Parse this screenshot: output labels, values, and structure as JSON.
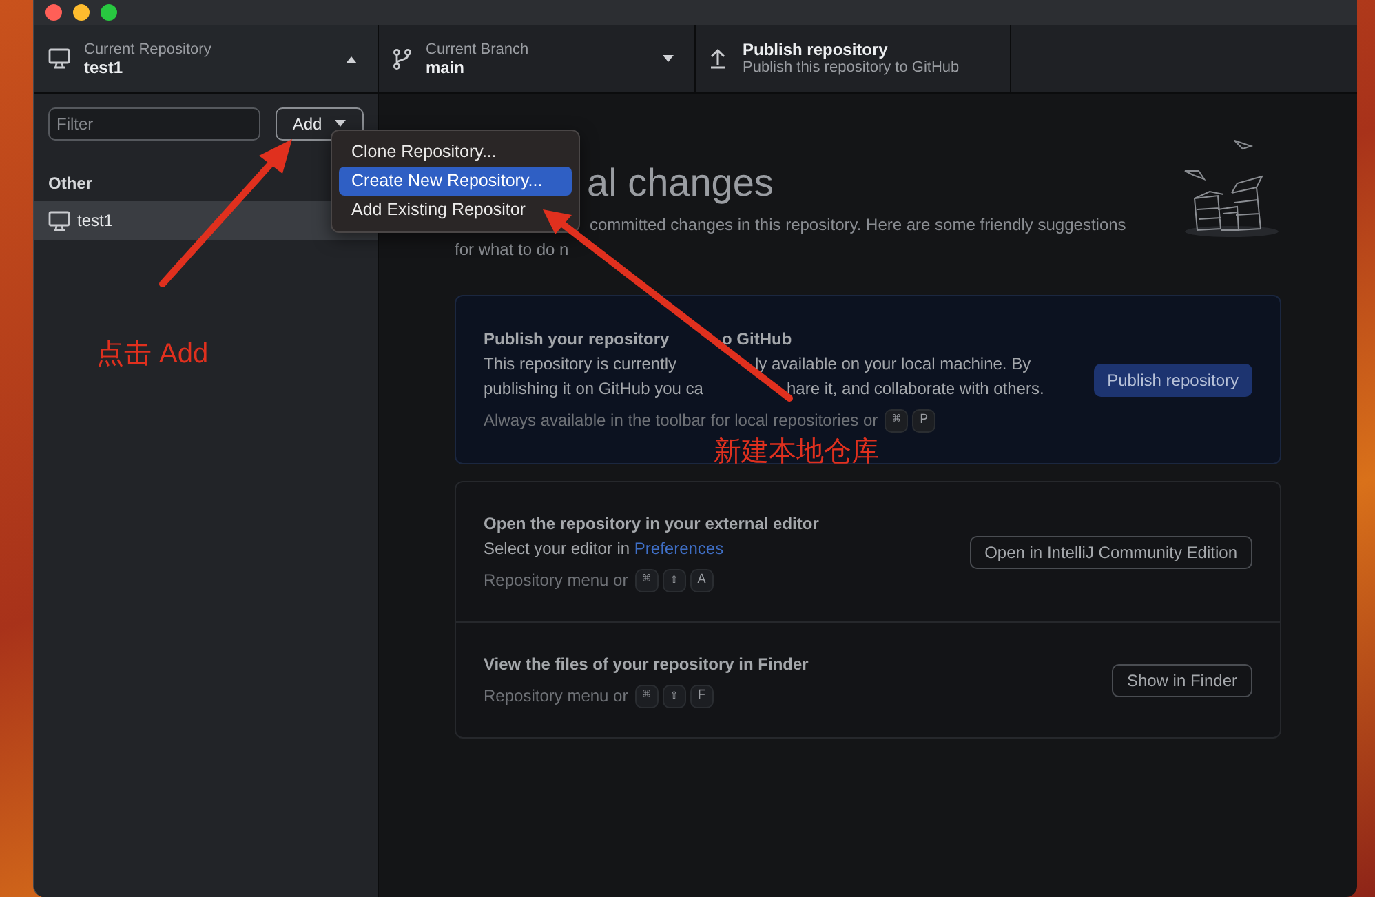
{
  "toolbar": {
    "repository": {
      "label": "Current Repository",
      "value": "test1"
    },
    "branch": {
      "label": "Current Branch",
      "value": "main"
    },
    "publish": {
      "title": "Publish repository",
      "subtitle": "Publish this repository to GitHub"
    }
  },
  "sidebar": {
    "filter": {
      "placeholder": "Filter"
    },
    "add_button": "Add",
    "group": "Other",
    "repositories": [
      {
        "name": "test1",
        "selected": true
      }
    ]
  },
  "add_menu": {
    "items": [
      {
        "label": "Clone Repository...",
        "selected": false
      },
      {
        "label": "Create New Repository...",
        "selected": true
      },
      {
        "label": "Add Existing Repositor",
        "selected": false
      }
    ]
  },
  "main": {
    "heading": "al changes",
    "description_lines": [
      "committed changes in this repository. Here are some friendly suggestions",
      "for what to do n"
    ],
    "cards": [
      {
        "kind": "highlight",
        "sections": [
          {
            "title_parts": [
              "Publish your repository",
              "o GitHub"
            ],
            "text_lines": [
              [
                "This repository is currently",
                "ly available on your local machine. By"
              ],
              [
                "publishing it on GitHub you ca",
                "hare it, and collaborate with others."
              ]
            ],
            "hint": "Always available in the toolbar for local repositories or",
            "keys": [
              "⌘",
              "P"
            ],
            "button": "Publish repository"
          }
        ]
      },
      {
        "kind": "plain",
        "sections": [
          {
            "title": "Open the repository in your external editor",
            "text": "Select your editor in",
            "link": "Preferences",
            "hint": "Repository menu or",
            "keys": [
              "⌘",
              "⇧",
              "A"
            ],
            "button": "Open in IntelliJ Community Edition"
          },
          {
            "title": "View the files of your repository in Finder",
            "hint": "Repository menu or",
            "keys": [
              "⌘",
              "⇧",
              "F"
            ],
            "button": "Show in Finder"
          }
        ]
      }
    ]
  },
  "annotations": [
    {
      "label": "点击 Add"
    },
    {
      "label": "新建本地仓库"
    }
  ]
}
